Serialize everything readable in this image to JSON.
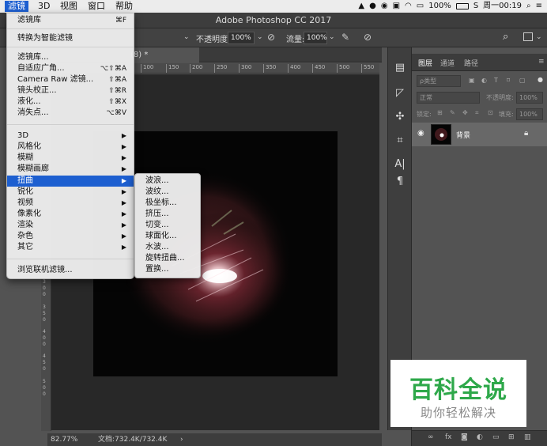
{
  "menubar": {
    "items": [
      "滤镜",
      "3D",
      "视图",
      "窗口",
      "帮助"
    ],
    "active_index": 0,
    "battery": "100%",
    "clock": "周一00:19"
  },
  "titlebar": {
    "title": "Adobe Photoshop CC 2017"
  },
  "options": {
    "opacity_label": "不透明度:",
    "opacity_value": "100%",
    "flow_label": "流量:",
    "flow_value": "100%"
  },
  "document": {
    "tab_title": "(8) *",
    "ruler_top": [
      "100",
      "150",
      "200",
      "250",
      "300",
      "350",
      "400",
      "450",
      "500",
      "550"
    ],
    "ruler_left": [
      "3\n0\n0",
      "3\n5\n0",
      "4\n0\n0",
      "4\n5\n0",
      "5\n0\n0"
    ],
    "zoom": "82.77%",
    "doc_info": "文档:732.4K/732.4K"
  },
  "filter_menu": {
    "items": [
      {
        "label": "滤镜库",
        "shortcut": "⌘F"
      },
      {
        "label": "转换为智能滤镜",
        "shortcut": ""
      },
      {
        "label": "滤镜库...",
        "shortcut": ""
      },
      {
        "label": "自适应广角...",
        "shortcut": "⌥⇧⌘A"
      },
      {
        "label": "Camera Raw 滤镜...",
        "shortcut": "⇧⌘A"
      },
      {
        "label": "镜头校正...",
        "shortcut": "⇧⌘R"
      },
      {
        "label": "液化...",
        "shortcut": "⇧⌘X"
      },
      {
        "label": "消失点...",
        "shortcut": "⌥⌘V"
      },
      {
        "label": "3D",
        "shortcut": ""
      },
      {
        "label": "风格化",
        "shortcut": ""
      },
      {
        "label": "模糊",
        "shortcut": ""
      },
      {
        "label": "模糊画廊",
        "shortcut": ""
      },
      {
        "label": "扭曲",
        "shortcut": ""
      },
      {
        "label": "锐化",
        "shortcut": ""
      },
      {
        "label": "视频",
        "shortcut": ""
      },
      {
        "label": "像素化",
        "shortcut": ""
      },
      {
        "label": "渲染",
        "shortcut": ""
      },
      {
        "label": "杂色",
        "shortcut": ""
      },
      {
        "label": "其它",
        "shortcut": ""
      },
      {
        "label": "浏览联机滤镜...",
        "shortcut": ""
      }
    ],
    "highlighted": "扭曲"
  },
  "distort_submenu": {
    "items": [
      "波浪...",
      "波纹...",
      "极坐标...",
      "挤压...",
      "切变...",
      "球面化...",
      "水波...",
      "旋转扭曲...",
      "置换..."
    ]
  },
  "layers_panel": {
    "tabs": [
      "图层",
      "通道",
      "路径"
    ],
    "filter_label": "ρ类型",
    "blend_mode": "正常",
    "opacity_label": "不透明度:",
    "opacity_value": "100%",
    "lock_label": "锁定:",
    "fill_label": "填充:",
    "fill_value": "100%",
    "layer_name": "背景"
  },
  "watermark": {
    "title": "百科全说",
    "subtitle": "助你轻松解决"
  },
  "colors": {
    "highlight": "#1d5fd0",
    "watermark_green": "#2ea84a"
  }
}
